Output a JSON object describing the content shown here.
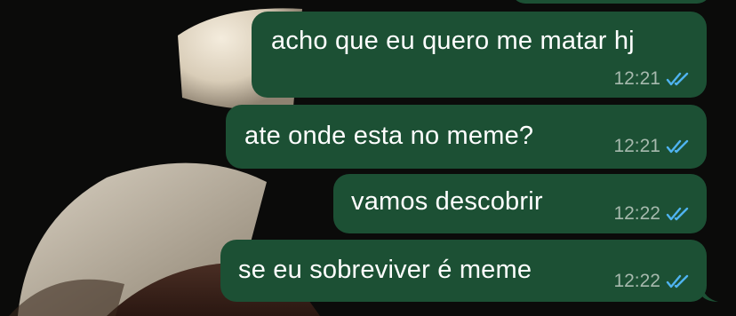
{
  "chat": {
    "messages": [
      {
        "text": "acho que eu quero me matar hj",
        "time": "12:21",
        "status": "read"
      },
      {
        "text": "ate onde esta no meme?",
        "time": "12:21",
        "status": "read"
      },
      {
        "text": "vamos descobrir",
        "time": "12:22",
        "status": "read"
      },
      {
        "text": "se eu sobreviver é meme",
        "time": "12:22",
        "status": "read"
      }
    ],
    "read_icon": "double-check-icon"
  },
  "colors": {
    "bubble": "#1c5034",
    "meta_text": "#a6b9ad",
    "read_ticks": "#4fb3f0",
    "background": "#0b0b0a"
  }
}
